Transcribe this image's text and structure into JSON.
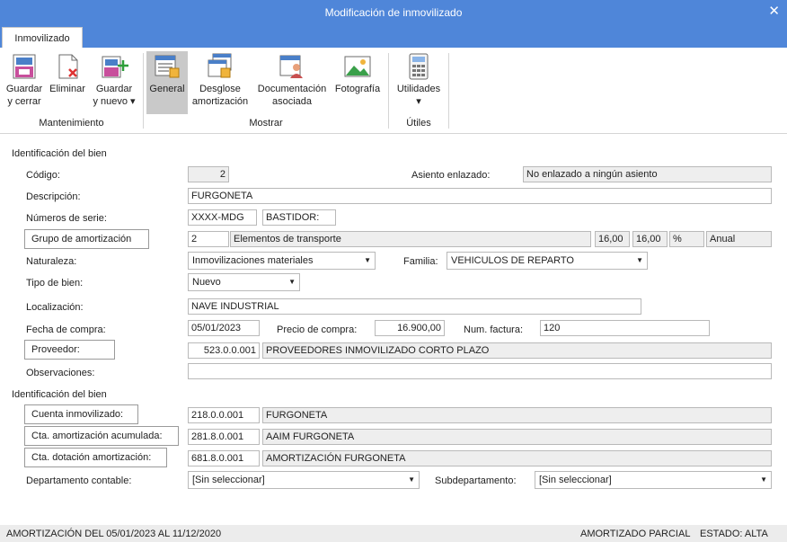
{
  "window": {
    "title": "Modificación de inmovilizado"
  },
  "tabs": [
    {
      "label": "Inmovilizado"
    }
  ],
  "ribbon": {
    "buttons": {
      "guardar_cerrar": {
        "line1": "Guardar",
        "line2": "y cerrar"
      },
      "eliminar": {
        "line1": "Eliminar"
      },
      "guardar_nuevo": {
        "line1": "Guardar",
        "line2": "y nuevo ▾"
      },
      "general": {
        "line1": "General"
      },
      "desglose": {
        "line1": "Desglose",
        "line2": "amortización"
      },
      "documentacion": {
        "line1": "Documentación",
        "line2": "asociada"
      },
      "fotografia": {
        "line1": "Fotografía"
      },
      "utilidades": {
        "line1": "Utilidades",
        "line2": "▾"
      }
    },
    "groups": {
      "mantenimiento": "Mantenimiento",
      "mostrar": "Mostrar",
      "utiles": "Útiles"
    }
  },
  "form": {
    "section1": "Identificación del bien",
    "codigo": {
      "label": "Código:",
      "value": "2"
    },
    "asiento": {
      "label": "Asiento enlazado:",
      "value": "No enlazado a ningún asiento"
    },
    "descripcion": {
      "label": "Descripción:",
      "value": "FURGONETA"
    },
    "series": {
      "label": "Números de serie:",
      "value1": "XXXX-MDG",
      "value2": "BASTIDOR:"
    },
    "grupo": {
      "label": "Grupo de amortización",
      "code": "2",
      "name": "Elementos de transporte",
      "v1": "16,00",
      "v2": "16,00",
      "unit": "%",
      "period": "Anual"
    },
    "naturaleza": {
      "label": "Naturaleza:",
      "value": "Inmovilizaciones materiales"
    },
    "familia": {
      "label": "Familia:",
      "value": "VEHICULOS DE REPARTO"
    },
    "tipo": {
      "label": "Tipo de bien:",
      "value": "Nuevo"
    },
    "localizacion": {
      "label": "Localización:",
      "value": "NAVE INDUSTRIAL"
    },
    "fecha": {
      "label": "Fecha de compra:",
      "value": "05/01/2023"
    },
    "precio": {
      "label": "Precio de compra:",
      "value": "16.900,00"
    },
    "factura": {
      "label": "Num. factura:",
      "value": "120"
    },
    "proveedor": {
      "label": "Proveedor:",
      "code": "523.0.0.001",
      "name": "PROVEEDORES INMOVILIZADO CORTO PLAZO"
    },
    "observaciones": {
      "label": "Observaciones:",
      "value": ""
    },
    "section2": "Identificación del bien",
    "cuenta_inm": {
      "label": "Cuenta inmovilizado:",
      "code": "218.0.0.001",
      "name": "FURGONETA"
    },
    "cta_amort": {
      "label": "Cta. amortización acumulada:",
      "code": "281.8.0.001",
      "name": "AAIM FURGONETA"
    },
    "cta_dot": {
      "label": "Cta. dotación amortización:",
      "code": "681.8.0.001",
      "name": "AMORTIZACIÓN FURGONETA"
    },
    "departamento": {
      "label": "Departamento contable:",
      "value": "[Sin seleccionar]"
    },
    "subdepartamento": {
      "label": "Subdepartamento:",
      "value": "[Sin seleccionar]"
    }
  },
  "status": {
    "left": "AMORTIZACIÓN DEL 05/01/2023 AL 11/12/2020",
    "middle": "AMORTIZADO PARCIAL",
    "right": "ESTADO: ALTA"
  }
}
